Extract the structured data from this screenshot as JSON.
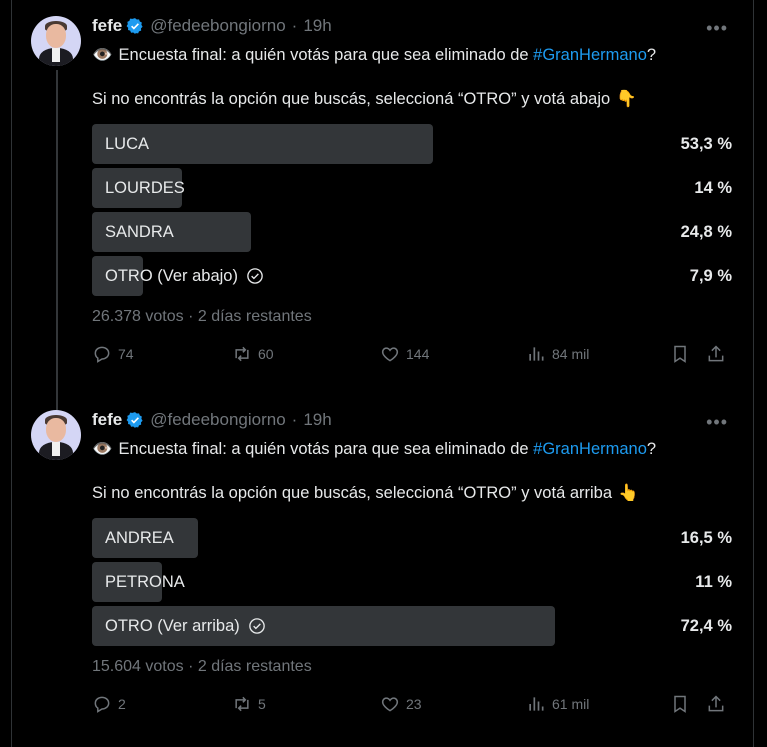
{
  "tweets": [
    {
      "name": "fefe",
      "handle": "@fedeebongiorno",
      "time": "19h",
      "line1_pre": "Encuesta final: a quién votás para que sea eliminado de ",
      "hashtag": "#GranHermano",
      "line1_post": "?",
      "line2": "Si no encontrás la opción que buscás, seleccioná “OTRO” y votá abajo",
      "hand_emoji": "👇",
      "poll": [
        {
          "label": "LUCA",
          "pct": "53,3 %",
          "value": 53.3,
          "checked": false
        },
        {
          "label": "LOURDES",
          "pct": "14 %",
          "value": 14,
          "checked": false
        },
        {
          "label": "SANDRA",
          "pct": "24,8 %",
          "value": 24.8,
          "checked": false
        },
        {
          "label": "OTRO (Ver abajo)",
          "pct": "7,9 %",
          "value": 7.9,
          "checked": true
        }
      ],
      "meta": "26.378 votos · 2 días restantes",
      "replies": "74",
      "retweets": "60",
      "likes": "144",
      "views": "84 mil"
    },
    {
      "name": "fefe",
      "handle": "@fedeebongiorno",
      "time": "19h",
      "line1_pre": "Encuesta final: a quién votás para que sea eliminado de ",
      "hashtag": "#GranHermano",
      "line1_post": "?",
      "line2": "Si no encontrás la opción que buscás, seleccioná “OTRO” y votá arriba",
      "hand_emoji": "👆",
      "poll": [
        {
          "label": "ANDREA",
          "pct": "16,5 %",
          "value": 16.5,
          "checked": false
        },
        {
          "label": "PETRONA",
          "pct": "11 %",
          "value": 11,
          "checked": false
        },
        {
          "label": "OTRO (Ver arriba)",
          "pct": "72,4 %",
          "value": 72.4,
          "checked": true
        }
      ],
      "meta": "15.604 votos · 2 días restantes",
      "replies": "2",
      "retweets": "5",
      "likes": "23",
      "views": "61 mil"
    }
  ],
  "colors": {
    "background": "#000000",
    "text": "#e7e9ea",
    "muted": "#71767b",
    "accent": "#1d9bf0",
    "poll_fill": "#333639"
  },
  "icons": [
    "eye-icon",
    "verified-badge-icon",
    "more-icon",
    "check-circle-icon",
    "reply-icon",
    "retweet-icon",
    "like-icon",
    "views-icon",
    "bookmark-icon",
    "share-icon"
  ]
}
